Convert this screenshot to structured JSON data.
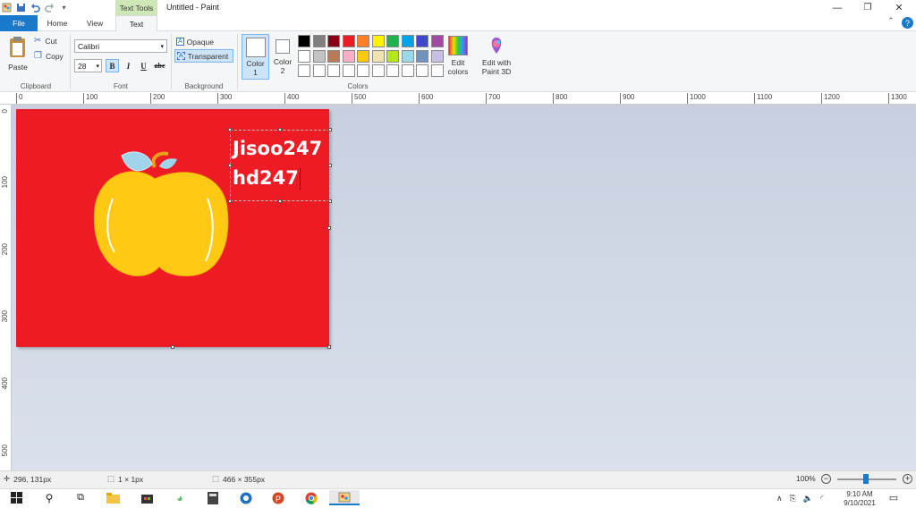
{
  "window": {
    "title": "Untitled - Paint",
    "context_tab": "Text Tools"
  },
  "tabs": {
    "file": "File",
    "home": "Home",
    "view": "View",
    "text": "Text"
  },
  "clipboard": {
    "paste": "Paste",
    "cut": "Cut",
    "copy": "Copy",
    "group": "Clipboard"
  },
  "font": {
    "family": "Calibri",
    "size": "28",
    "bold": "B",
    "italic": "I",
    "underline": "U",
    "strike": "abc",
    "group": "Font"
  },
  "background": {
    "opaque": "Opaque",
    "transparent": "Transparent",
    "group": "Background"
  },
  "colors": {
    "color1": "Color",
    "color1_num": "1",
    "color2": "Color",
    "color2_num": "2",
    "edit": "Edit",
    "edit2": "colors",
    "paint3d": "Edit with",
    "paint3d2": "Paint 3D",
    "group": "Colors",
    "palette_row1": [
      "#000000",
      "#7f7f7f",
      "#880015",
      "#ed1c24",
      "#ff7f27",
      "#fff200",
      "#22b14c",
      "#00a2e8",
      "#3f48cc",
      "#a349a4"
    ],
    "palette_row2": [
      "#ffffff",
      "#c3c3c3",
      "#b97a57",
      "#ffaec9",
      "#ffc90e",
      "#efe4b0",
      "#b5e61d",
      "#99d9ea",
      "#7092be",
      "#c8bfe7"
    ],
    "palette_row3": [
      "#ffffff",
      "#ffffff",
      "#ffffff",
      "#ffffff",
      "#ffffff",
      "#ffffff",
      "#ffffff",
      "#ffffff",
      "#ffffff",
      "#ffffff"
    ]
  },
  "ruler": {
    "h": [
      "0",
      "100",
      "200",
      "300",
      "400",
      "500",
      "600",
      "700",
      "800",
      "900",
      "1000",
      "1100",
      "1200",
      "1300"
    ],
    "v": [
      "0",
      "100",
      "200",
      "300",
      "400",
      "500"
    ]
  },
  "canvas_text": {
    "line1": "Jisoo247",
    "line2": "hd247"
  },
  "status": {
    "cursor": "296, 131px",
    "selection": "1 × 1px",
    "size": "466 × 355px",
    "zoom": "100%"
  },
  "tray": {
    "time": "9:10 AM",
    "date": "9/10/2021"
  }
}
